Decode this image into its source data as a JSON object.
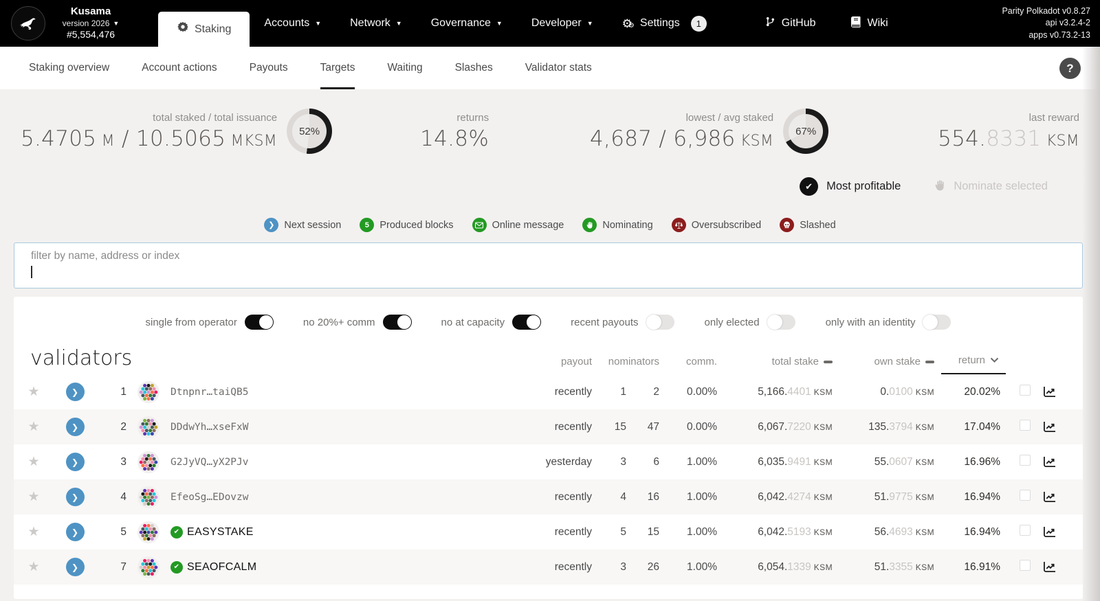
{
  "header": {
    "chain": {
      "name": "Kusama",
      "version": "version 2026",
      "block": "#5,554,476"
    },
    "nav": [
      {
        "label": "Staking",
        "active": true
      },
      {
        "label": "Accounts"
      },
      {
        "label": "Network"
      },
      {
        "label": "Governance"
      },
      {
        "label": "Developer"
      },
      {
        "label": "Settings",
        "badge": "1"
      }
    ],
    "links": [
      {
        "label": "GitHub"
      },
      {
        "label": "Wiki"
      }
    ],
    "node_info": [
      "Parity Polkadot v0.8.27",
      "api v3.2.4-2",
      "apps v0.73.2-13"
    ]
  },
  "tabs": {
    "items": [
      "Staking overview",
      "Account actions",
      "Payouts",
      "Targets",
      "Waiting",
      "Slashes",
      "Validator stats"
    ],
    "active": "Targets"
  },
  "summary": [
    {
      "label": "total staked / total issuance",
      "parts": [
        {
          "t": "5.4705"
        },
        {
          "t": " M",
          "u": true
        },
        {
          "t": " / "
        },
        {
          "t": "10.5065"
        },
        {
          "t": " MKSM",
          "u": true
        }
      ],
      "donut": 52
    },
    {
      "label": "returns",
      "parts": [
        {
          "t": "14.8%"
        }
      ]
    },
    {
      "label": "lowest / avg staked",
      "parts": [
        {
          "t": "4,687 / 6,986"
        },
        {
          "t": " KSM",
          "u": true
        }
      ],
      "donut": 67
    },
    {
      "label": "last reward",
      "parts": [
        {
          "t": "554."
        },
        {
          "t": "8331",
          "dim": true
        },
        {
          "t": " KSM",
          "u": true
        }
      ]
    }
  ],
  "actions": {
    "most_profitable": "Most profitable",
    "nominate_selected": "Nominate selected"
  },
  "legend": [
    {
      "label": "Next session",
      "color": "#4e93c4",
      "icon": "chevron-right-icon"
    },
    {
      "label": "Produced blocks",
      "color": "#239a23",
      "icon": "count-5-icon",
      "text": "5"
    },
    {
      "label": "Online message",
      "color": "#239a23",
      "icon": "envelope-icon"
    },
    {
      "label": "Nominating",
      "color": "#239a23",
      "icon": "hand-icon"
    },
    {
      "label": "Oversubscribed",
      "color": "#8c1d1d",
      "icon": "scales-icon"
    },
    {
      "label": "Slashed",
      "color": "#8c1d1d",
      "icon": "skull-icon"
    }
  ],
  "filter": {
    "placeholder": "filter by name, address or index"
  },
  "toggles": [
    {
      "label": "single from operator",
      "on": true
    },
    {
      "label": "no 20%+ comm",
      "on": true
    },
    {
      "label": "no at capacity",
      "on": true
    },
    {
      "label": "recent payouts",
      "on": false
    },
    {
      "label": "only elected",
      "on": false
    },
    {
      "label": "only with an identity",
      "on": false
    }
  ],
  "table": {
    "title": "validators",
    "unit": "KSM",
    "columns": {
      "payout": "payout",
      "nominators": "nominators",
      "comm": "comm.",
      "total_stake": "total stake",
      "own_stake": "own stake",
      "return": "return"
    },
    "rows": [
      {
        "index": "1",
        "name": "Dtnpnr…taiQB5",
        "named": false,
        "verified": false,
        "payout": "recently",
        "nominators": [
          "1",
          "2"
        ],
        "comm": "0.00%",
        "total_stake": "5,166.4401",
        "own_stake": "0.0100",
        "return": "20.02%"
      },
      {
        "index": "2",
        "name": "DDdwYh…xseFxW",
        "named": false,
        "verified": false,
        "payout": "recently",
        "nominators": [
          "15",
          "47"
        ],
        "comm": "0.00%",
        "total_stake": "6,067.7220",
        "own_stake": "135.3794",
        "return": "17.04%"
      },
      {
        "index": "3",
        "name": "G2JyVQ…yX2PJv",
        "named": false,
        "verified": false,
        "payout": "yesterday",
        "nominators": [
          "3",
          "6"
        ],
        "comm": "1.00%",
        "total_stake": "6,035.9491",
        "own_stake": "55.0607",
        "return": "16.96%"
      },
      {
        "index": "4",
        "name": "EfeoSg…EDovzw",
        "named": false,
        "verified": false,
        "payout": "recently",
        "nominators": [
          "4",
          "16"
        ],
        "comm": "1.00%",
        "total_stake": "6,042.4274",
        "own_stake": "51.9775",
        "return": "16.94%"
      },
      {
        "index": "5",
        "name": "EASYSTAKE",
        "named": true,
        "verified": true,
        "payout": "recently",
        "nominators": [
          "5",
          "15"
        ],
        "comm": "1.00%",
        "total_stake": "6,042.5193",
        "own_stake": "56.4693",
        "return": "16.94%"
      },
      {
        "index": "7",
        "name": "SEAOFCALM",
        "named": true,
        "verified": true,
        "payout": "recently",
        "nominators": [
          "3",
          "26"
        ],
        "comm": "1.00%",
        "total_stake": "6,054.1339",
        "own_stake": "51.3355",
        "return": "16.91%"
      }
    ]
  },
  "colors": {
    "accent_blue": "#4e93c4",
    "ok_green": "#239a23",
    "alert_red": "#8c1d1d",
    "donut_fill": "#1a1a1a",
    "donut_track": "#dcd9d7"
  }
}
